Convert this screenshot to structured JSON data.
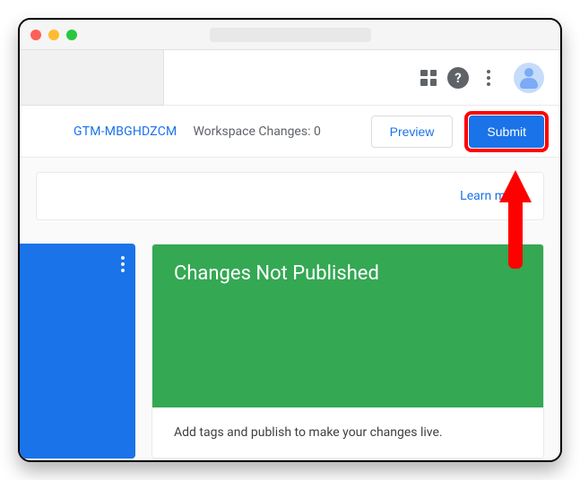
{
  "header": {
    "apps_label": "apps",
    "help_label": "?",
    "more_label": "more"
  },
  "subbar": {
    "container_id": "GTM-MBGHDZCM",
    "workspace_label": "Workspace Changes:",
    "workspace_count": "0",
    "preview_label": "Preview",
    "submit_label": "Submit"
  },
  "banner": {
    "learn_more": "Learn more"
  },
  "green_card": {
    "title": "Changes Not Published",
    "subtitle": "Add tags and publish to make your changes live."
  }
}
